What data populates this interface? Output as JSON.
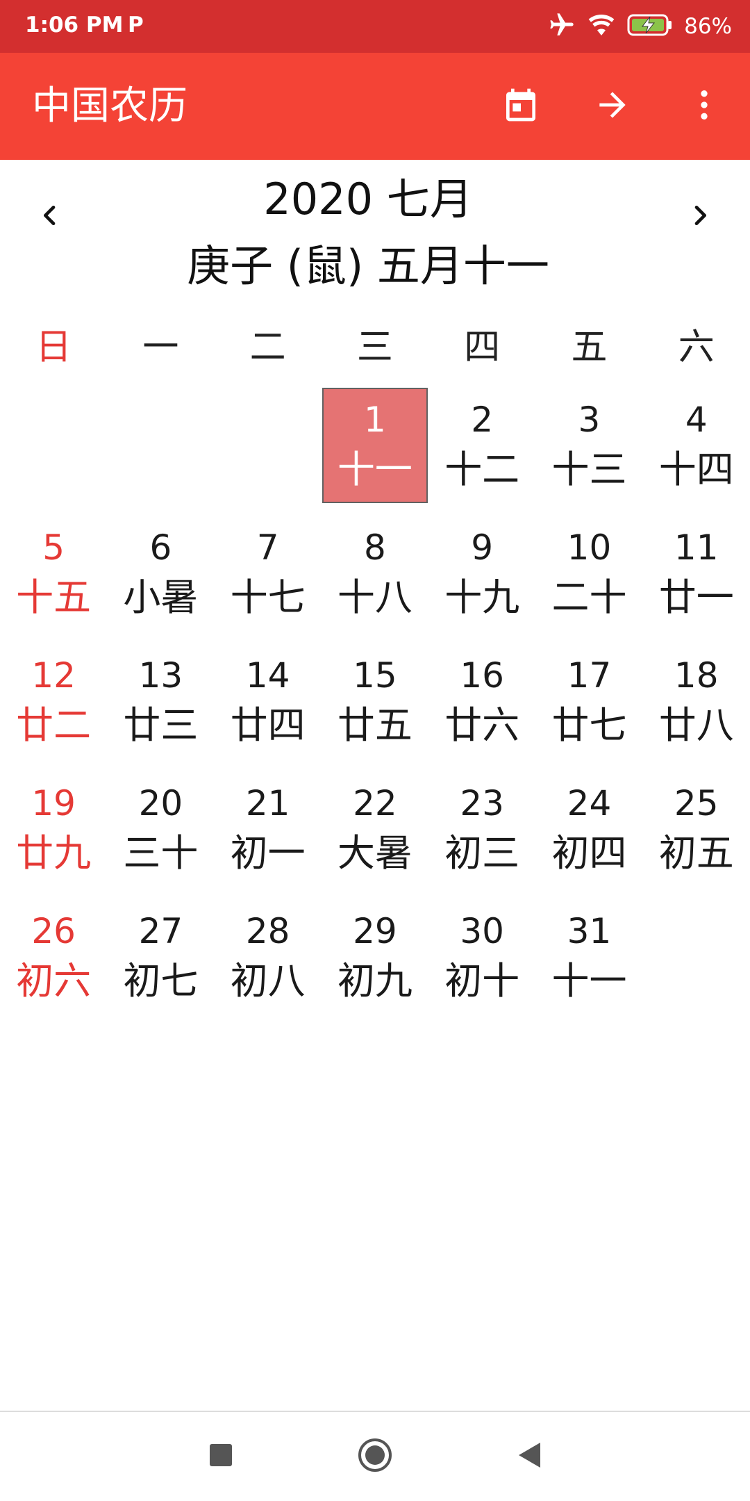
{
  "status_bar": {
    "time": "1:06 PM",
    "app_indicator": "P",
    "battery_percent": "86%",
    "icons": [
      "airplane-icon",
      "wifi-icon",
      "battery-charging-icon"
    ]
  },
  "app_bar": {
    "title": "中国农历",
    "actions": [
      "calendar-today-icon",
      "arrow-forward-icon",
      "more-vert-icon"
    ]
  },
  "calendar": {
    "month_title": "2020 七月",
    "lunar_title": "庚子 (鼠) 五月十一",
    "weekdays": [
      "日",
      "一",
      "二",
      "三",
      "四",
      "五",
      "六"
    ],
    "days": [
      {
        "n": "",
        "l": ""
      },
      {
        "n": "",
        "l": ""
      },
      {
        "n": "",
        "l": ""
      },
      {
        "n": "1",
        "l": "十一",
        "selected": true
      },
      {
        "n": "2",
        "l": "十二"
      },
      {
        "n": "3",
        "l": "十三"
      },
      {
        "n": "4",
        "l": "十四"
      },
      {
        "n": "5",
        "l": "十五"
      },
      {
        "n": "6",
        "l": "小暑"
      },
      {
        "n": "7",
        "l": "十七"
      },
      {
        "n": "8",
        "l": "十八"
      },
      {
        "n": "9",
        "l": "十九"
      },
      {
        "n": "10",
        "l": "二十"
      },
      {
        "n": "11",
        "l": "廿一"
      },
      {
        "n": "12",
        "l": "廿二"
      },
      {
        "n": "13",
        "l": "廿三"
      },
      {
        "n": "14",
        "l": "廿四"
      },
      {
        "n": "15",
        "l": "廿五"
      },
      {
        "n": "16",
        "l": "廿六"
      },
      {
        "n": "17",
        "l": "廿七"
      },
      {
        "n": "18",
        "l": "廿八"
      },
      {
        "n": "19",
        "l": "廿九"
      },
      {
        "n": "20",
        "l": "三十"
      },
      {
        "n": "21",
        "l": "初一"
      },
      {
        "n": "22",
        "l": "大暑"
      },
      {
        "n": "23",
        "l": "初三"
      },
      {
        "n": "24",
        "l": "初四"
      },
      {
        "n": "25",
        "l": "初五"
      },
      {
        "n": "26",
        "l": "初六"
      },
      {
        "n": "27",
        "l": "初七"
      },
      {
        "n": "28",
        "l": "初八"
      },
      {
        "n": "29",
        "l": "初九"
      },
      {
        "n": "30",
        "l": "初十"
      },
      {
        "n": "31",
        "l": "十一"
      }
    ]
  },
  "colors": {
    "status_bar": "#d32f2f",
    "app_bar": "#f44336",
    "sunday": "#e53935",
    "selected_day": "#e57373"
  },
  "system_nav": [
    "recents-square-icon",
    "home-circle-icon",
    "back-triangle-icon"
  ]
}
